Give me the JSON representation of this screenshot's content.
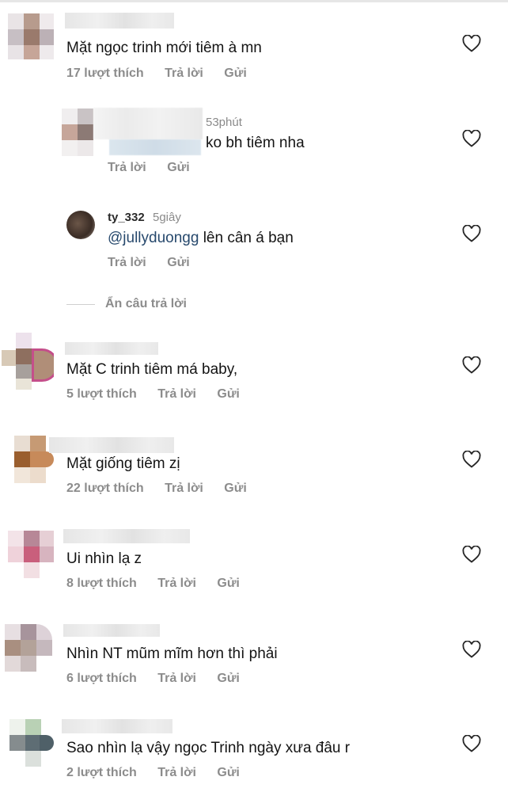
{
  "comments": [
    {
      "text": "Mặt ngọc trinh mới tiêm à mn",
      "likes": "17 lượt thích",
      "reply": "Trả lời",
      "send": "Gửi"
    },
    {
      "time": "53phút",
      "text": "ko bh tiêm nha",
      "reply": "Trả lời",
      "send": "Gửi"
    },
    {
      "username": "ty_332",
      "time": "5giây",
      "mention": "@jullyduongg",
      "text": " lên cân á bạn",
      "reply": "Trả lời",
      "send": "Gửi"
    },
    {
      "text": "Mặt C trinh tiêm má baby,",
      "likes": "5 lượt thích",
      "reply": "Trả lời",
      "send": "Gửi"
    },
    {
      "text": "Mặt giống tiêm zị",
      "likes": "22 lượt thích",
      "reply": "Trả lời",
      "send": "Gửi"
    },
    {
      "text": "Ui nhìn lạ z",
      "likes": "8 lượt thích",
      "reply": "Trả lời",
      "send": "Gửi"
    },
    {
      "text": "Nhìn NT mũm mĩm hơn thì phải",
      "likes": "6 lượt thích",
      "reply": "Trả lời",
      "send": "Gửi"
    },
    {
      "text": "Sao nhìn lạ vậy ngọc Trinh ngày xưa đâu r",
      "likes": "2 lượt thích",
      "reply": "Trả lời",
      "send": "Gửi"
    }
  ],
  "hide_replies": "Ẩn câu trả lời",
  "icons": {
    "like": "heart-outline-icon"
  },
  "colors": {
    "meta": "#8c8c8c",
    "mention": "#27496d"
  }
}
